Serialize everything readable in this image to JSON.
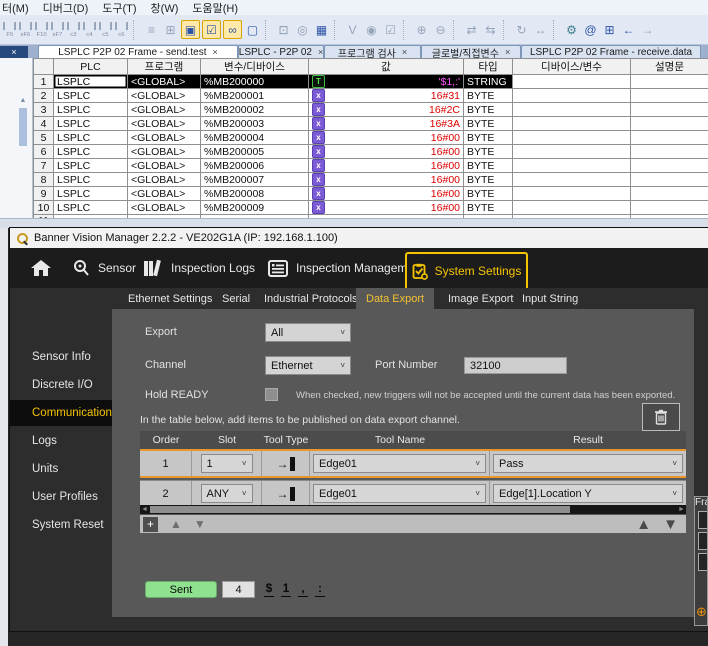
{
  "plc": {
    "menu": [
      {
        "label": "터(M)"
      },
      {
        "label": "디버그(D)"
      },
      {
        "label": "도구(T)"
      },
      {
        "label": "창(W)"
      },
      {
        "label": "도움말(H)"
      }
    ],
    "toolbar": {
      "fkeys": [
        "F5",
        "sF6",
        "F10",
        "sF7",
        "c3",
        "c4",
        "c5",
        "c6"
      ],
      "icons": [
        {
          "name": "list-icon",
          "g": "≡"
        },
        {
          "name": "grid-icon",
          "g": "⊞"
        },
        {
          "name": "folder-icon",
          "g": "▣"
        },
        {
          "name": "monitor-check-icon",
          "g": "☑"
        },
        {
          "name": "binoculars-icon",
          "g": "∞"
        },
        {
          "name": "frame-icon",
          "g": "▢"
        },
        {
          "name": "clipboard-icon",
          "g": "⊡"
        },
        {
          "name": "target-icon",
          "g": "◎"
        },
        {
          "name": "chart-icon",
          "g": "▦"
        },
        {
          "name": "contact-v-icon",
          "g": "V"
        },
        {
          "name": "coil-icon",
          "g": "◉"
        },
        {
          "name": "check-icon",
          "g": "☑"
        },
        {
          "name": "zoom-in-icon",
          "g": "⊕"
        },
        {
          "name": "zoom-out-icon",
          "g": "⊖"
        },
        {
          "name": "swap-icon",
          "g": "⇄"
        },
        {
          "name": "swap-alt-icon",
          "g": "⇆"
        },
        {
          "name": "refresh-icon",
          "g": "↻"
        },
        {
          "name": "resize-icon",
          "g": "↔"
        },
        {
          "name": "gear-icon",
          "g": "⚙"
        },
        {
          "name": "at-icon",
          "g": "@"
        },
        {
          "name": "table-icon",
          "g": "⊞"
        },
        {
          "name": "back-icon",
          "g": "←"
        },
        {
          "name": "forward-icon",
          "g": "→"
        }
      ]
    },
    "tabs": [
      {
        "label": "LSPLC P2P 02 Frame - send.test",
        "close": "×"
      },
      {
        "label": "LSPLC - P2P 02",
        "close": "×"
      },
      {
        "label": "프로그램 검사",
        "close": "×"
      },
      {
        "label": "글로벌/직접변수",
        "close": "×"
      },
      {
        "label": "LSPLC P2P 02 Frame - receive.data",
        "close": ""
      }
    ],
    "grid": {
      "headers": [
        "PLC",
        "프로그램",
        "변수/디바이스",
        "값",
        "타입",
        "디바이스/변수",
        "설명문"
      ],
      "rows": [
        {
          "n": "1",
          "plc": "LSPLC",
          "prog": "<GLOBAL>",
          "dev": "%MB200000",
          "icon": "T",
          "val": "'$1,:'",
          "type": "STRING"
        },
        {
          "n": "2",
          "plc": "LSPLC",
          "prog": "<GLOBAL>",
          "dev": "%MB200001",
          "icon": "x",
          "val": "16#31",
          "type": "BYTE"
        },
        {
          "n": "3",
          "plc": "LSPLC",
          "prog": "<GLOBAL>",
          "dev": "%MB200002",
          "icon": "x",
          "val": "16#2C",
          "type": "BYTE"
        },
        {
          "n": "4",
          "plc": "LSPLC",
          "prog": "<GLOBAL>",
          "dev": "%MB200003",
          "icon": "x",
          "val": "16#3A",
          "type": "BYTE"
        },
        {
          "n": "5",
          "plc": "LSPLC",
          "prog": "<GLOBAL>",
          "dev": "%MB200004",
          "icon": "x",
          "val": "16#00",
          "type": "BYTE"
        },
        {
          "n": "6",
          "plc": "LSPLC",
          "prog": "<GLOBAL>",
          "dev": "%MB200005",
          "icon": "x",
          "val": "16#00",
          "type": "BYTE"
        },
        {
          "n": "7",
          "plc": "LSPLC",
          "prog": "<GLOBAL>",
          "dev": "%MB200006",
          "icon": "x",
          "val": "16#00",
          "type": "BYTE"
        },
        {
          "n": "8",
          "plc": "LSPLC",
          "prog": "<GLOBAL>",
          "dev": "%MB200007",
          "icon": "x",
          "val": "16#00",
          "type": "BYTE"
        },
        {
          "n": "9",
          "plc": "LSPLC",
          "prog": "<GLOBAL>",
          "dev": "%MB200008",
          "icon": "x",
          "val": "16#00",
          "type": "BYTE"
        },
        {
          "n": "10",
          "plc": "LSPLC",
          "prog": "<GLOBAL>",
          "dev": "%MB200009",
          "icon": "x",
          "val": "16#00",
          "type": "BYTE"
        },
        {
          "n": "11",
          "plc": "",
          "prog": "",
          "dev": "",
          "icon": "",
          "val": "",
          "type": ""
        }
      ]
    }
  },
  "vm": {
    "title": "Banner Vision Manager 2.2.2 - VE202G1A (IP: 192.168.1.100)",
    "nav": {
      "sensor": "Sensor",
      "logs": "Inspection Logs",
      "mgmt": "Inspection Management",
      "settings": "System Settings"
    },
    "sidebar": [
      {
        "label": "Sensor Info"
      },
      {
        "label": "Discrete I/O"
      },
      {
        "label": "Communications"
      },
      {
        "label": "Logs"
      },
      {
        "label": "Units"
      },
      {
        "label": "User Profiles"
      },
      {
        "label": "System Reset"
      }
    ],
    "subtabs": [
      {
        "label": "Ethernet Settings"
      },
      {
        "label": "Serial"
      },
      {
        "label": "Industrial Protocols"
      },
      {
        "label": "Data Export"
      },
      {
        "label": "Image Export"
      },
      {
        "label": "Input String"
      }
    ],
    "form": {
      "export_label": "Export",
      "export_value": "All",
      "channel_label": "Channel",
      "channel_value": "Ethernet",
      "port_label": "Port Number",
      "port_value": "32100",
      "hold_label": "Hold READY",
      "hold_hint": "When checked, new triggers will not be accepted until the current data has been exported.",
      "note": "In the table below, add items to be published on data export channel."
    },
    "extable": {
      "headers": [
        "Order",
        "Slot",
        "Tool Type",
        "Tool Name",
        "Result"
      ],
      "rows": [
        {
          "order": "1",
          "slot": "1",
          "tool": "Edge01",
          "result": "Pass"
        },
        {
          "order": "2",
          "slot": "ANY",
          "tool": "Edge01",
          "result": "Edge[1].Location Y"
        }
      ]
    },
    "side": {
      "label": "Fra",
      "plus": "⊕"
    },
    "status": {
      "sent": "Sent",
      "count": "4",
      "chars": [
        "$",
        "1",
        ",",
        ":"
      ]
    }
  },
  "glyphs": {
    "chev": "˅",
    "up": "▲",
    "down": "▼",
    "left": "◄",
    "right": "►",
    "plus": "+",
    "close": "×"
  },
  "colors": {
    "accent_yellow": "#F5C400",
    "row_select_orange": "#E8962E",
    "sent_green": "#8FE08F",
    "value_red": "#E00000",
    "string_magenta": "#FF4FFF",
    "icon_purple": "#7B5CD6",
    "icon_green": "#3FBF3F"
  }
}
